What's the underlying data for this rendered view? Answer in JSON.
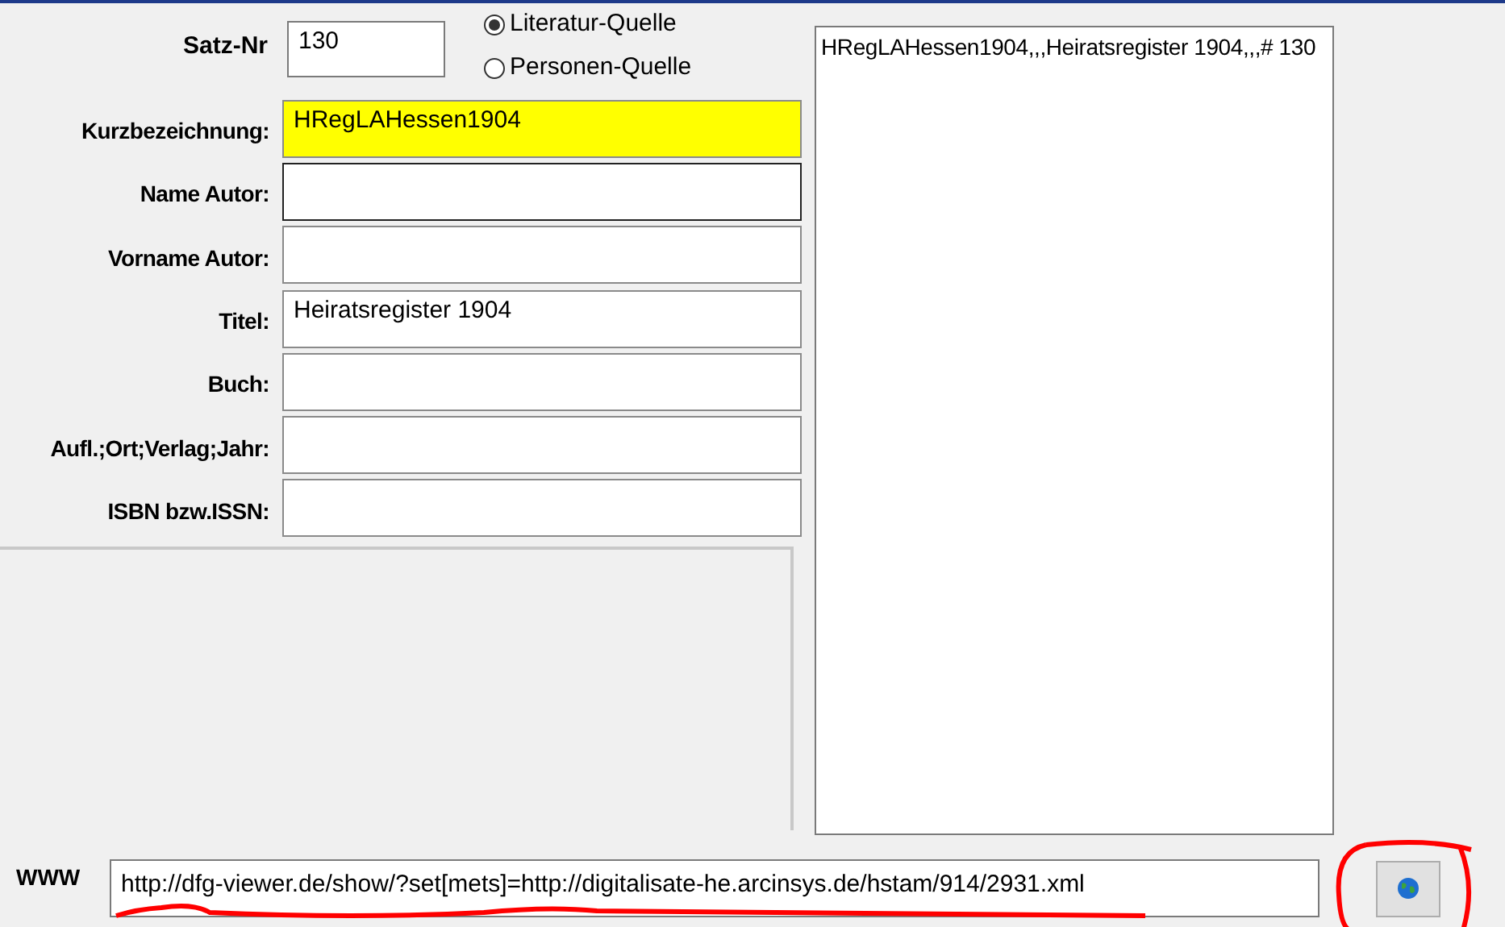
{
  "record_number": {
    "label": "Satz-Nr",
    "value": "130"
  },
  "source_type": [
    {
      "label": "Literatur-Quelle",
      "selected": true
    },
    {
      "label": "Personen-Quelle",
      "selected": false
    }
  ],
  "fields": [
    {
      "label": "Kurzbezeichnung:",
      "value": "HRegLAHessen1904",
      "highlighted": true,
      "focused": false
    },
    {
      "label": "Name Autor:",
      "highlighted": false,
      "focused": true
    },
    {
      "label": "Vorname Autor:",
      "highlighted": false,
      "focused": false
    },
    {
      "label": "Titel:",
      "value": "Heiratsregister 1904",
      "highlighted": false,
      "focused": false
    },
    {
      "label": "Buch:",
      "highlighted": false,
      "focused": false
    },
    {
      "label": "Aufl.;Ort;Verlag;Jahr:",
      "highlighted": false,
      "focused": false
    },
    {
      "label": "ISBN bzw.ISSN:",
      "highlighted": false,
      "focused": false
    }
  ],
  "preview": {
    "value": "HRegLAHessen1904,,,Heiratsregister 1904,,,# 130"
  },
  "www": {
    "label": "WWW",
    "value": "http://dfg-viewer.de/show/?set[mets]=http://digitalisate-he.arcinsys.de/hstam/914/2931.xml"
  }
}
